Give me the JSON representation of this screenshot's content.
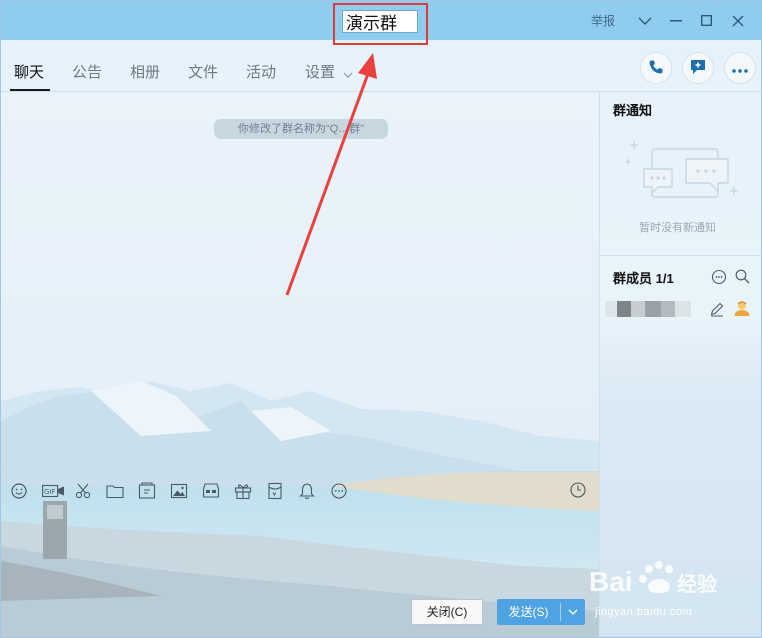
{
  "window": {
    "title_value": "演示群",
    "report_label": "举报"
  },
  "tabs": [
    "聊天",
    "公告",
    "相册",
    "文件",
    "活动",
    "设置"
  ],
  "chat": {
    "system_message": "你修改了群名称为“Q…群”"
  },
  "buttons": {
    "close_label": "关闭(C)",
    "send_label": "发送(S)"
  },
  "right_panel": {
    "notice_title": "群通知",
    "notice_empty": "暂时没有新通知",
    "members_title": "群成员 1/1"
  },
  "watermark": {
    "brand": "Bai du 经验",
    "url": "jingyan.baidu.com"
  },
  "colors": {
    "titlebar": "#8fccee",
    "accent_blue": "#4fa3e2",
    "annotation_red": "#e03a3a"
  },
  "icons": [
    "emoji-icon",
    "gif-icon",
    "scissors-icon",
    "folder-icon",
    "sticker-icon",
    "image-icon",
    "screen-share-icon",
    "gift-icon",
    "red-packet-icon",
    "bell-icon",
    "more-icon",
    "clock-icon",
    "phone-icon",
    "add-chat-icon",
    "ellipsis-icon",
    "search-icon",
    "edit-icon",
    "avatar-icon"
  ]
}
